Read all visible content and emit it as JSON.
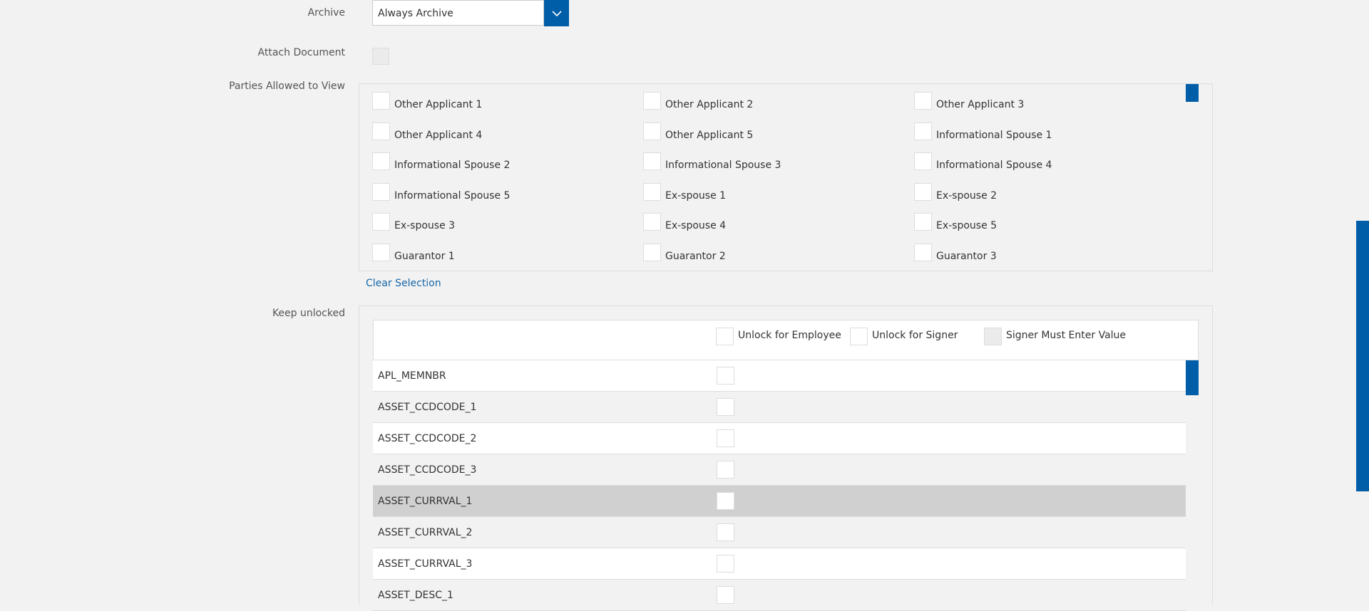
{
  "archive": {
    "label": "Archive",
    "value": "Always Archive"
  },
  "attach": {
    "label": "Attach Document"
  },
  "parties": {
    "label": "Parties Allowed to View",
    "items": [
      "Other Applicant 1",
      "Other Applicant 2",
      "Other Applicant 3",
      "Other Applicant 4",
      "Other Applicant 5",
      "Informational Spouse 1",
      "Informational Spouse 2",
      "Informational Spouse 3",
      "Informational Spouse 4",
      "Informational Spouse 5",
      "Ex-spouse 1",
      "Ex-spouse 2",
      "Ex-spouse 3",
      "Ex-spouse 4",
      "Ex-spouse 5",
      "Guarantor 1",
      "Guarantor 2",
      "Guarantor 3"
    ],
    "clear_label": "Clear Selection"
  },
  "unlock": {
    "label": "Keep unlocked",
    "header": {
      "employee": "Unlock for Employee",
      "signer": "Unlock for Signer",
      "must_enter": "Signer Must Enter Value"
    },
    "rows": [
      "APL_MEMNBR",
      "ASSET_CCDCODE_1",
      "ASSET_CCDCODE_2",
      "ASSET_CCDCODE_3",
      "ASSET_CURRVAL_1",
      "ASSET_CURRVAL_2",
      "ASSET_CURRVAL_3",
      "ASSET_DESC_1"
    ],
    "selected_row": "ASSET_CURRVAL_1"
  },
  "colors": {
    "accent": "#005ea8",
    "link": "#1766a8",
    "background": "#f2f2f2"
  }
}
